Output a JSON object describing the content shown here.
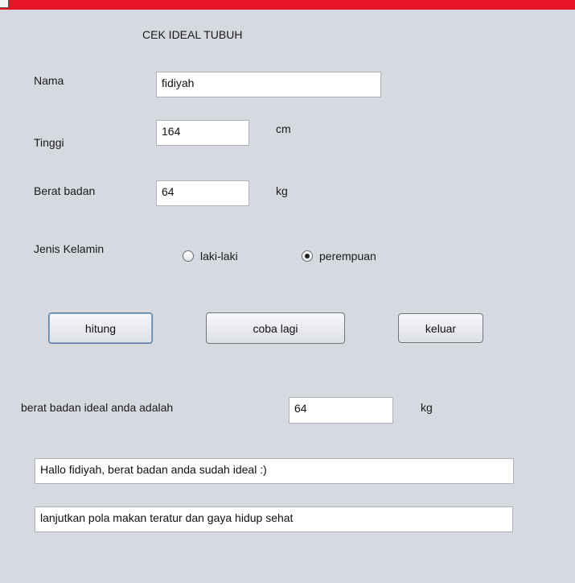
{
  "window": {
    "title_icon": "app-window-icon",
    "titlebar_color": "#e8142a"
  },
  "form": {
    "title": "CEK IDEAL TUBUH",
    "nama_label": "Nama",
    "nama_value": "fidiyah",
    "tinggi_label": "Tinggi",
    "tinggi_value": "164",
    "tinggi_unit": "cm",
    "berat_label": "Berat badan",
    "berat_value": "64",
    "berat_unit": "kg",
    "gender_label": "Jenis Kelamin",
    "gender_options": [
      {
        "label": "laki-laki",
        "selected": false
      },
      {
        "label": "perempuan",
        "selected": true
      }
    ]
  },
  "buttons": {
    "hitung": "hitung",
    "coba_lagi": "coba lagi",
    "keluar": "keluar"
  },
  "result": {
    "ideal_label": "berat badan ideal anda adalah",
    "ideal_value": "64",
    "ideal_unit": "kg",
    "message_1": "Hallo fidiyah, berat badan anda sudah ideal :)",
    "message_2": "lanjutkan pola makan teratur dan gaya hidup sehat"
  }
}
